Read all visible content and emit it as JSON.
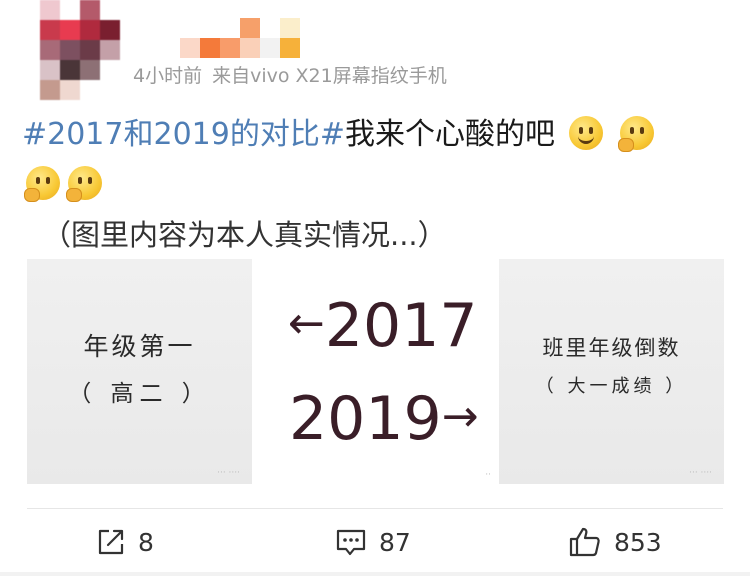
{
  "post": {
    "meta": {
      "time": "4小时前",
      "source": "来自vivo X21屏幕指纹手机"
    },
    "text": {
      "hashtag": "#2017和2019的对比#",
      "body": "我来个心酸的吧",
      "note": "（图里内容为本人真实情况...）"
    },
    "emojis": [
      "smile-emoji",
      "cover-mouth-emoji",
      "cover-mouth-emoji",
      "cover-mouth-emoji"
    ]
  },
  "images": {
    "left": {
      "title": "年级第一",
      "subtitle": "（ 高二 ）"
    },
    "center": {
      "year_top": "2017",
      "year_bottom": "2019",
      "arrow_left": "←",
      "arrow_right": "→"
    },
    "right": {
      "title": "班里年级倒数",
      "subtitle": "（ 大一成绩 ）"
    }
  },
  "actions": {
    "repost_count": "8",
    "comment_count": "87",
    "like_count": "853"
  },
  "colors": {
    "hashtag": "#4f7eb5",
    "meta": "#9a9a9a",
    "year_text": "#3a1e28"
  },
  "icons": {
    "repost": "repost-icon",
    "comment": "comment-icon",
    "like": "thumbs-up-icon"
  }
}
